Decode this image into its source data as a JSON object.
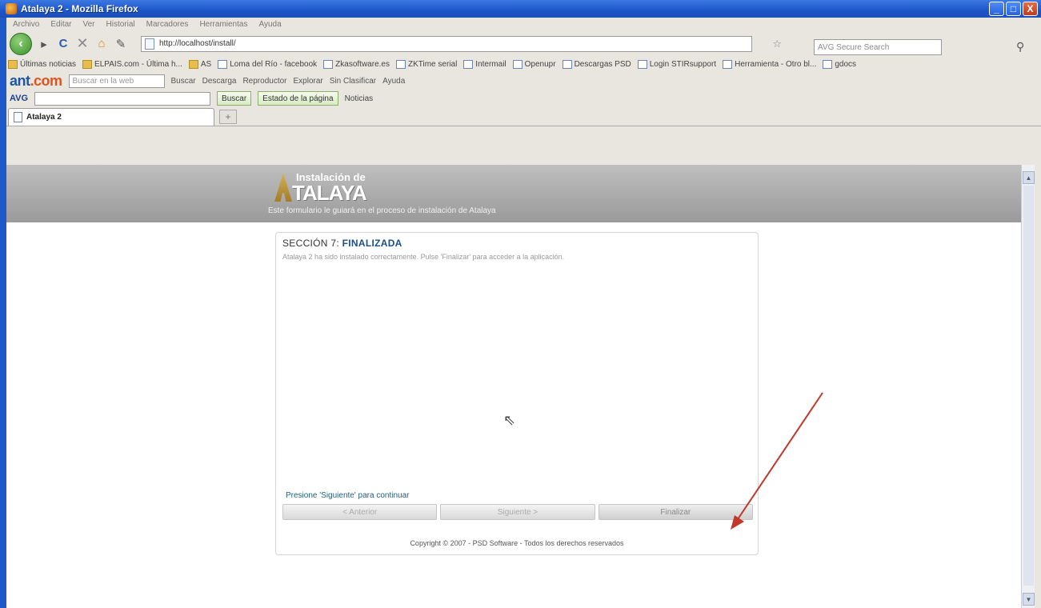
{
  "window": {
    "title": "Atalaya 2 - Mozilla Firefox",
    "buttons": {
      "minimize": "_",
      "maximize": "□",
      "close": "X"
    }
  },
  "menubar": {
    "items": [
      "Archivo",
      "Editar",
      "Ver",
      "Historial",
      "Marcadores",
      "Herramientas",
      "Ayuda"
    ]
  },
  "navbar": {
    "url": "http://localhost/install/",
    "search_placeholder": "AVG Secure Search"
  },
  "bookmarks": {
    "items": [
      {
        "label": "Últimas noticias",
        "icon": "folder-icon"
      },
      {
        "label": "ELPAIS.com - Última h...",
        "icon": "folder-icon"
      },
      {
        "label": "AS",
        "icon": "folder-icon"
      },
      {
        "label": "Loma del Río - facebook",
        "icon": "page-icon"
      },
      {
        "label": "Zkasoftware.es",
        "icon": "page-icon"
      },
      {
        "label": "ZKTime serial",
        "icon": "page-icon"
      },
      {
        "label": "Intermail",
        "icon": "page-icon"
      },
      {
        "label": "Openupr",
        "icon": "page-icon"
      },
      {
        "label": "Descargas PSD",
        "icon": "page-icon"
      },
      {
        "label": "Login STIRsupport",
        "icon": "page-icon"
      },
      {
        "label": "Herramienta - Otro bl...",
        "icon": "page-icon"
      },
      {
        "label": "gdocs",
        "icon": "page-icon"
      }
    ]
  },
  "antbar": {
    "logo_main": "ant",
    "logo_suffix": ".com",
    "search_placeholder": "Buscar en la web",
    "buttons": [
      "Buscar",
      "Descarga",
      "Reproductor",
      "Explorar",
      "Sin Clasificar",
      "Ayuda"
    ]
  },
  "avgbar": {
    "logo": "AVG",
    "search_button": "Buscar",
    "page_status_button": "Estado de la página",
    "news_button": "Noticias"
  },
  "tabs": [
    {
      "label": "Atalaya 2"
    }
  ],
  "newtab_label": "+",
  "page": {
    "header": {
      "logo_line1": "Instalación de",
      "logo_line2": "TALAYA",
      "subtitle": "Este formulario le guiará en el proceso de instalación de Atalaya"
    },
    "section": {
      "title_prefix": "SECCIÓN 7:",
      "title_highlight": "FINALIZADA",
      "description": "Atalaya 2 ha sido instalado correctamente. Pulse 'Finalizar' para acceder a la aplicación."
    },
    "hint": "Presione 'Siguiente' para continuar",
    "buttons": {
      "previous": "< Anterior",
      "next": "Siguiente >",
      "finish": "Finalizar"
    },
    "copyright": "Copyright © 2007 - PSD Software - Todos los derechos reservados"
  },
  "colors": {
    "titlebar": "#1d55c8",
    "header_gray": "#a8a8a8",
    "section_highlight": "#1a4f8a",
    "annotation_arrow": "#c0392b"
  }
}
